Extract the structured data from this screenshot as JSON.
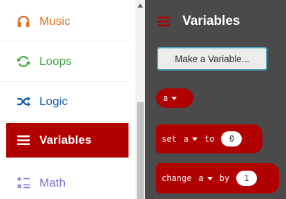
{
  "sidebar": {
    "items": [
      {
        "label": "Music",
        "icon": "headphones-icon",
        "color": "#e0722a"
      },
      {
        "label": "Loops",
        "icon": "refresh-icon",
        "color": "#40a640"
      },
      {
        "label": "Logic",
        "icon": "shuffle-icon",
        "color": "#0f5aa8"
      },
      {
        "label": "Variables",
        "icon": "list-icon",
        "color": "#b00000",
        "selected": true
      },
      {
        "label": "Math",
        "icon": "math-icon",
        "color": "#7d6fd0"
      }
    ]
  },
  "flyout": {
    "title": "Variables",
    "title_icon": "list-icon",
    "make_variable_label": "Make a Variable...",
    "block_color": "#b00000",
    "variable_block": {
      "name": "a"
    },
    "set_block": {
      "keyword": "set",
      "variable": "a",
      "to_label": "to",
      "value": "0"
    },
    "change_block": {
      "keyword": "change",
      "variable": "a",
      "by_label": "by",
      "value": "1"
    }
  }
}
